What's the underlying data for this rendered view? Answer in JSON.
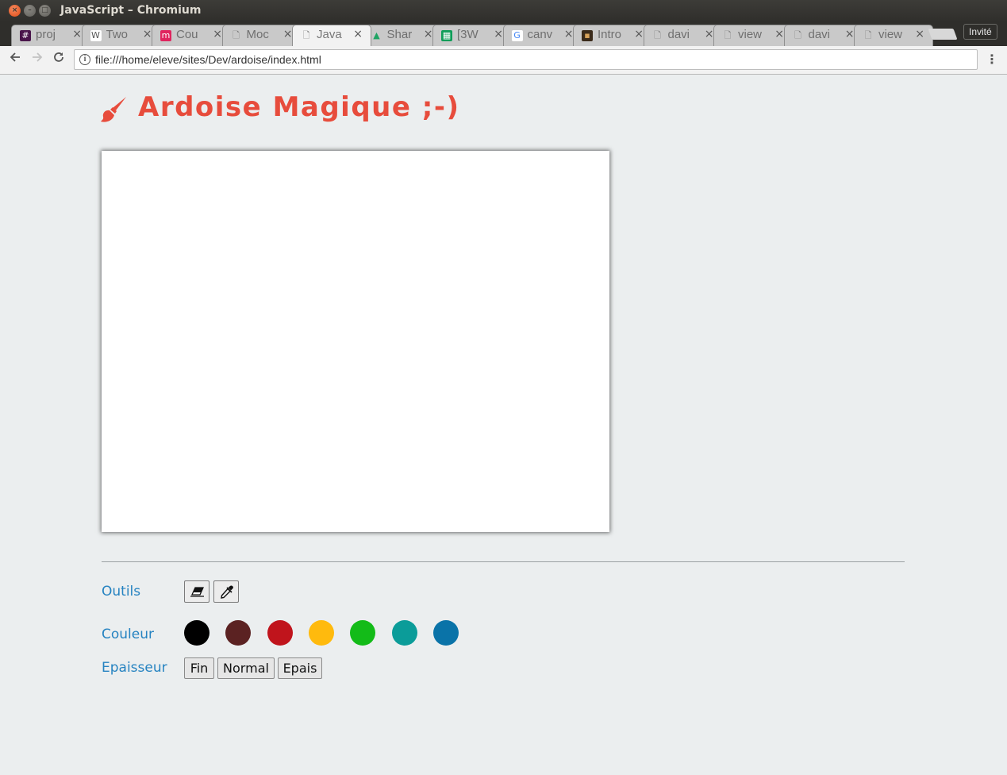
{
  "window": {
    "title": "JavaScript – Chromium"
  },
  "tabs": [
    {
      "label": "proj",
      "icon": "slack-icon",
      "active": false
    },
    {
      "label": "Two",
      "icon": "wordpress-icon",
      "active": false
    },
    {
      "label": "Cou",
      "icon": "moodle-icon",
      "active": false
    },
    {
      "label": "Moc",
      "icon": "page-icon",
      "active": false
    },
    {
      "label": "Java",
      "icon": "page-icon",
      "active": true
    },
    {
      "label": "Shar",
      "icon": "drive-icon",
      "active": false
    },
    {
      "label": "[3W",
      "icon": "sheets-icon",
      "active": false
    },
    {
      "label": "canv",
      "icon": "google-icon",
      "active": false
    },
    {
      "label": "Intro",
      "icon": "image-icon",
      "active": false
    },
    {
      "label": "davi",
      "icon": "page-icon",
      "active": false
    },
    {
      "label": "view",
      "icon": "page-icon",
      "active": false
    },
    {
      "label": "davi",
      "icon": "page-icon",
      "active": false
    },
    {
      "label": "view",
      "icon": "page-icon",
      "active": false
    }
  ],
  "profile_button": "Invité",
  "address_bar": {
    "url": "file:///home/eleve/sites/Dev/ardoise/index.html"
  },
  "page": {
    "title": "Ardoise Magique ;-)",
    "title_color": "#e74c3c",
    "label_color": "#2683c1",
    "tools_label": "Outils",
    "tools": [
      {
        "name": "eraser-icon"
      },
      {
        "name": "eyedropper-icon"
      }
    ],
    "color_label": "Couleur",
    "colors": [
      "#000000",
      "#5b2222",
      "#c0141c",
      "#ffba0d",
      "#13bb18",
      "#0b9c99",
      "#0a73a8"
    ],
    "thickness_label": "Epaisseur",
    "thickness_options": [
      "Fin",
      "Normal",
      "Epais"
    ]
  }
}
